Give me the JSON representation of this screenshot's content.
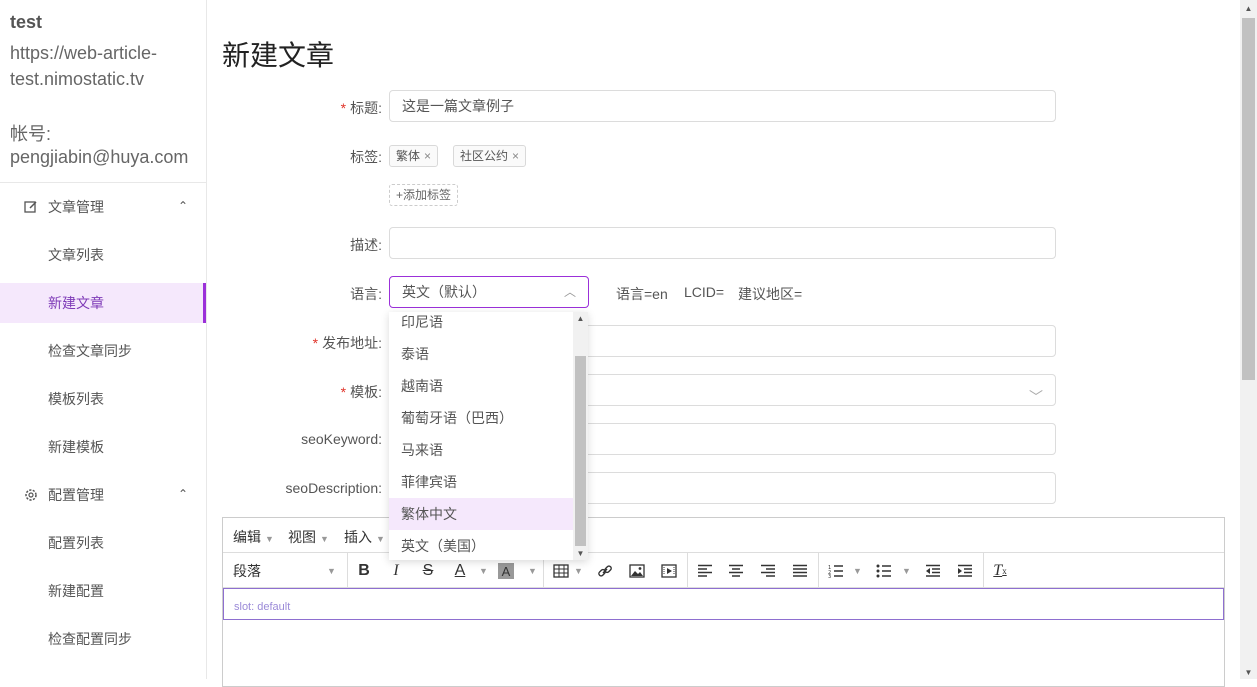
{
  "sidebar": {
    "site_name": "test",
    "site_url": "https://web-article-test.nimostatic.tv",
    "account_label": "帐号:",
    "account_value": "pengjiabin@huya.com",
    "groups": [
      {
        "label": "文章管理",
        "icon": "edit-icon",
        "items": [
          "文章列表",
          "新建文章",
          "检查文章同步",
          "模板列表",
          "新建模板"
        ]
      },
      {
        "label": "配置管理",
        "icon": "gear-icon",
        "items": [
          "配置列表",
          "新建配置",
          "检查配置同步"
        ]
      }
    ],
    "active_item": "新建文章"
  },
  "page": {
    "title": "新建文章"
  },
  "form": {
    "title_label": "标题:",
    "title_value": "这是一篇文章例子",
    "tags_label": "标签:",
    "tags": [
      "繁体",
      "社区公约"
    ],
    "add_tag": "+添加标签",
    "desc_label": "描述:",
    "lang_label": "语言:",
    "lang_value": "英文（默认）",
    "lang_info": {
      "lang": "语言=en",
      "lcid": "LCID=",
      "region": "建议地区="
    },
    "publish_label": "发布地址:",
    "template_label": "模板:",
    "seo_keyword_label": "seoKeyword:",
    "seo_desc_label": "seoDescription:"
  },
  "dropdown": {
    "options": [
      "印尼语",
      "泰语",
      "越南语",
      "葡萄牙语（巴西）",
      "马来语",
      "菲律宾语",
      "繁体中文",
      "英文（美国）"
    ],
    "hovered": "繁体中文"
  },
  "editor": {
    "menus": [
      "编辑",
      "视图",
      "插入"
    ],
    "format": "段落",
    "placeholder": "slot: default"
  },
  "colors": {
    "accent": "#9b30d9",
    "active_bg": "#f5e8fc",
    "required": "#e0342a"
  }
}
